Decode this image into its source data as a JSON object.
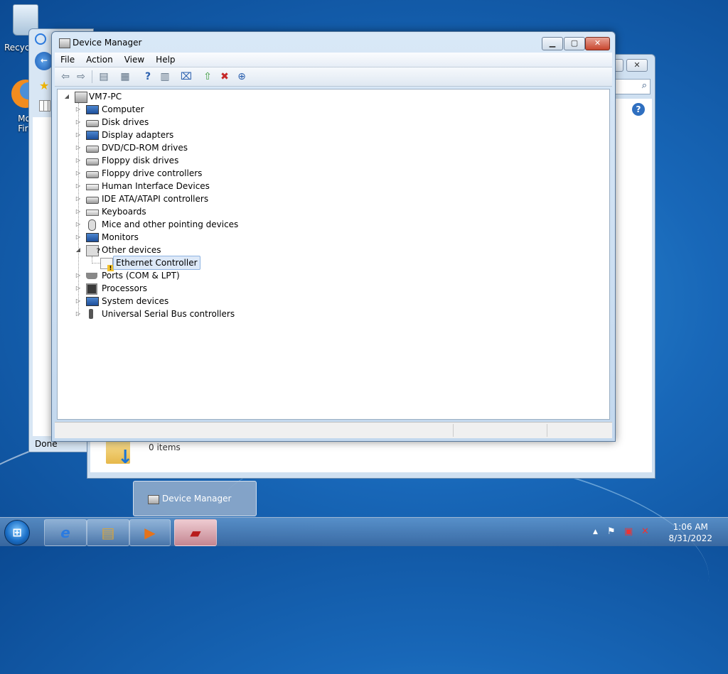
{
  "desktop": {
    "icons": [
      {
        "label": "Recycle Bin",
        "visible_label": "Recyc"
      },
      {
        "label": "Mozilla Firefox",
        "visible_label_1": "Mo:",
        "visible_label_2": "Fire"
      }
    ]
  },
  "ie_window": {
    "status": "Done"
  },
  "explorer_window": {
    "items_count": "0 items"
  },
  "device_manager": {
    "title": "Device Manager",
    "menu": [
      "File",
      "Action",
      "View",
      "Help"
    ],
    "toolbar_icons": [
      "back-icon",
      "forward-icon",
      "show-hide-console-tree-icon",
      "properties-icon",
      "help-icon",
      "action-pane-icon",
      "scan-hardware-icon",
      "update-driver-icon",
      "uninstall-icon",
      "disable-icon"
    ],
    "tree": {
      "root": "VM7-PC",
      "items": [
        {
          "label": "Computer",
          "icon": "computer-icon",
          "expanded": false
        },
        {
          "label": "Disk drives",
          "icon": "disk-drive-icon",
          "expanded": false
        },
        {
          "label": "Display adapters",
          "icon": "display-adapter-icon",
          "expanded": false
        },
        {
          "label": "DVD/CD-ROM drives",
          "icon": "dvd-drive-icon",
          "expanded": false
        },
        {
          "label": "Floppy disk drives",
          "icon": "floppy-drive-icon",
          "expanded": false
        },
        {
          "label": "Floppy drive controllers",
          "icon": "floppy-controller-icon",
          "expanded": false
        },
        {
          "label": "Human Interface Devices",
          "icon": "hid-icon",
          "expanded": false
        },
        {
          "label": "IDE ATA/ATAPI controllers",
          "icon": "ide-controller-icon",
          "expanded": false
        },
        {
          "label": "Keyboards",
          "icon": "keyboard-icon",
          "expanded": false
        },
        {
          "label": "Mice and other pointing devices",
          "icon": "mouse-icon",
          "expanded": false
        },
        {
          "label": "Monitors",
          "icon": "monitor-icon",
          "expanded": false
        },
        {
          "label": "Other devices",
          "icon": "unknown-device-icon",
          "expanded": true,
          "children": [
            {
              "label": "Ethernet Controller",
              "icon": "warning-device-icon",
              "selected": true
            }
          ]
        },
        {
          "label": "Ports (COM & LPT)",
          "icon": "port-icon",
          "expanded": false
        },
        {
          "label": "Processors",
          "icon": "processor-icon",
          "expanded": false
        },
        {
          "label": "System devices",
          "icon": "system-device-icon",
          "expanded": false
        },
        {
          "label": "Universal Serial Bus controllers",
          "icon": "usb-icon",
          "expanded": false
        }
      ]
    }
  },
  "taskbar": {
    "thumbnail_label": "Device Manager",
    "clock_time": "1:06 AM",
    "clock_date": "8/31/2022",
    "tray_icons": [
      "show-hidden-icons-arrow",
      "action-center-flag-icon",
      "network-icon",
      "volume-muted-icon"
    ]
  }
}
